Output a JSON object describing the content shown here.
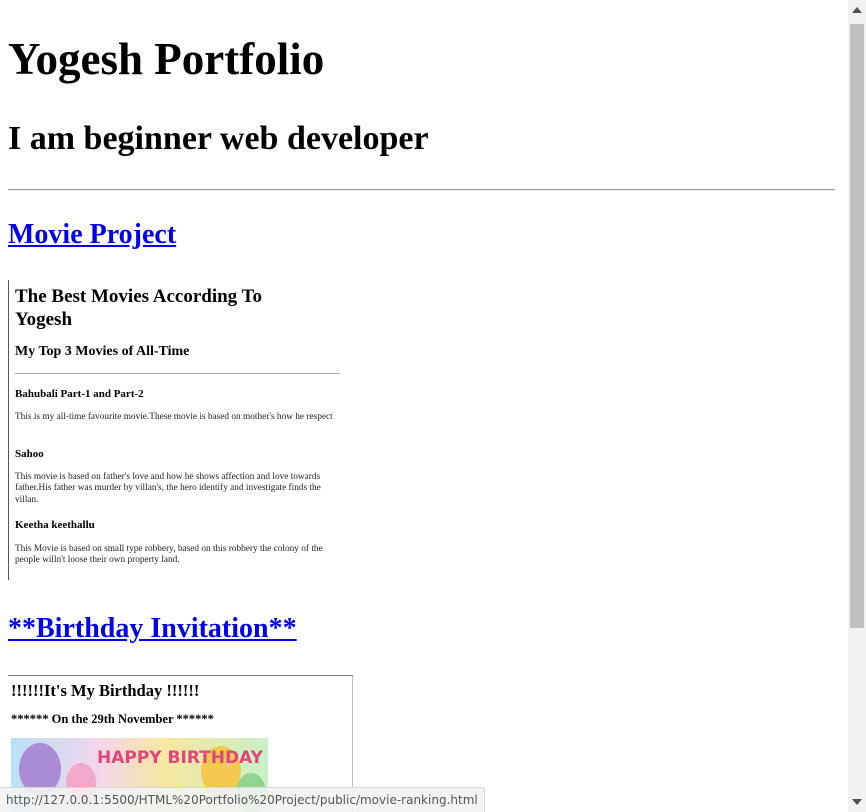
{
  "page": {
    "heading": "Yogesh Portfolio",
    "subheading": "I am beginner web developer"
  },
  "movie_section": {
    "link_label": "Movie Project",
    "frame": {
      "title": "The Best Movies According To Yogesh",
      "subtitle": "My Top 3 Movies of All-Time",
      "movies": [
        {
          "name": "Bahubali Part-1 and Part-2",
          "description": "This is my all-time favourite movie.These movie is based on mother's how he respect"
        },
        {
          "name": "Sahoo",
          "description": "This movie is based on father's love and how he shows affection and love towards father.His father was murder by villan's, the hero identify and investigate finds the villan."
        },
        {
          "name": "Keetha keethallu",
          "description": "This Movie is based on small type robbery, based on this robbery the colony of the people willn't loose their own property land."
        }
      ]
    }
  },
  "birthday_section": {
    "link_label": "**Birthday Invitation**",
    "frame": {
      "title": "!!!!!!It's My Birthday !!!!!!",
      "subtitle": "****** On the 29th November ******",
      "image_text": "HAPPY BIRTHDAY"
    }
  },
  "status_bar": {
    "url": "http://127.0.0.1:5500/HTML%20Portfolio%20Project/public/movie-ranking.html"
  },
  "colors": {
    "link": "#0000ee",
    "scrollbar_track": "#f1f1f1",
    "scrollbar_thumb": "#c1c1c1"
  }
}
